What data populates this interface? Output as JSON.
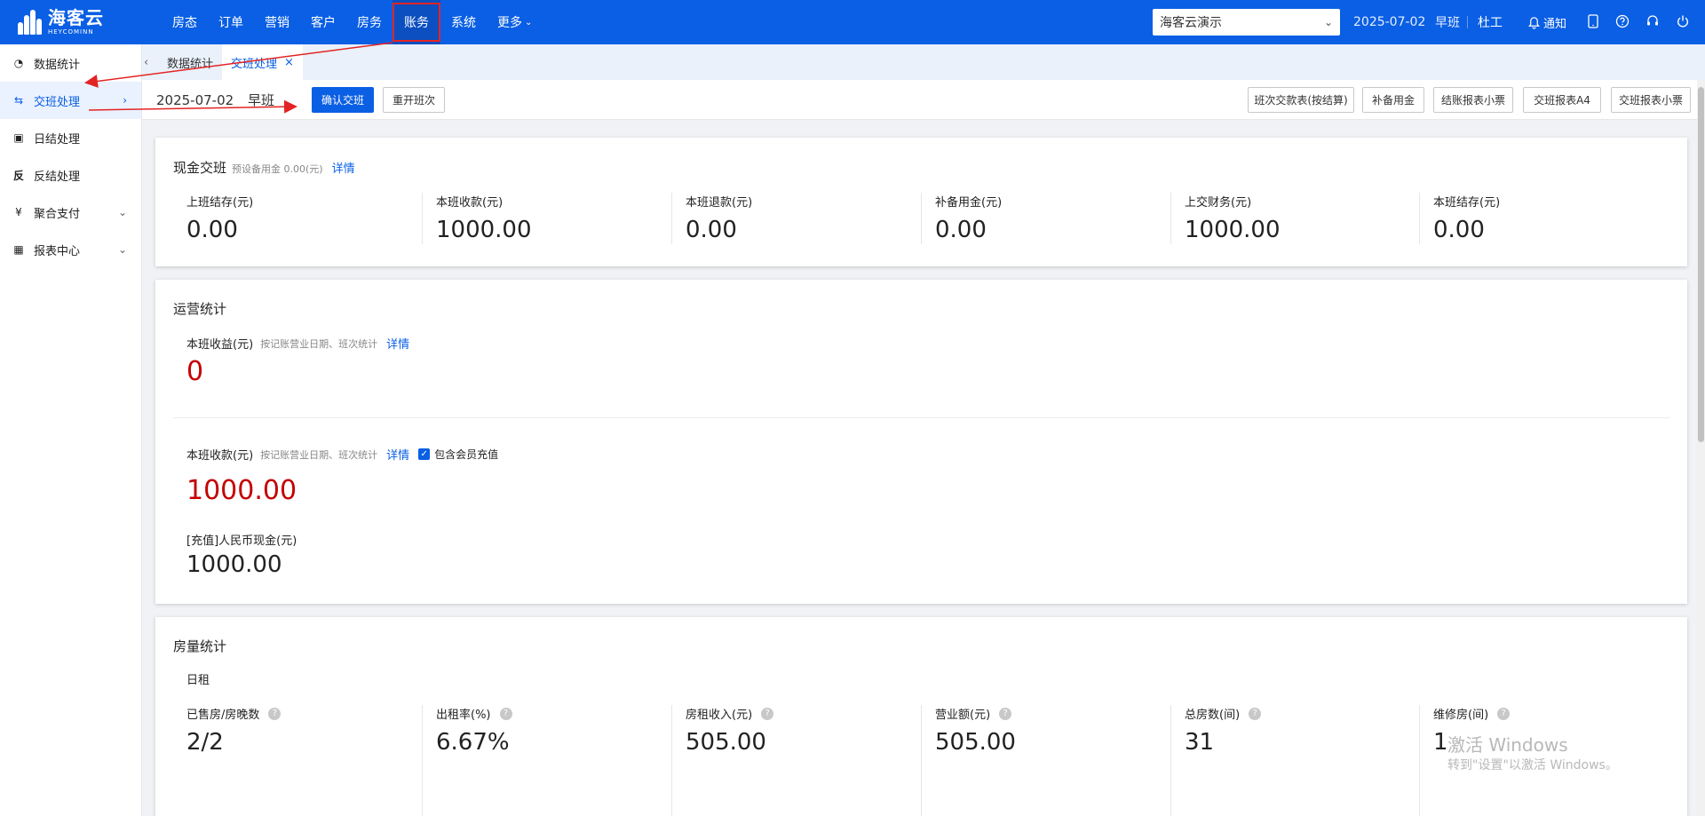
{
  "brand": {
    "name_cn": "海客云",
    "name_en": "HEYCOMINN"
  },
  "nav": {
    "items": [
      {
        "label": "房态"
      },
      {
        "label": "订单"
      },
      {
        "label": "营销"
      },
      {
        "label": "客户"
      },
      {
        "label": "房务"
      },
      {
        "label": "账务",
        "active": true
      },
      {
        "label": "系统"
      },
      {
        "label": "更多"
      }
    ]
  },
  "header": {
    "hotel": "海客云演示",
    "date": "2025-07-02",
    "shift": "早班",
    "user": "杜工",
    "notify": "通知",
    "icons": [
      "bell-icon",
      "tablet-icon",
      "help-icon",
      "headset-icon",
      "power-icon"
    ]
  },
  "sidebar": {
    "items": [
      {
        "label": "数据统计",
        "icon": "pie-chart-icon"
      },
      {
        "label": "交班处理",
        "icon": "exchange-icon",
        "active": true
      },
      {
        "label": "日结处理",
        "icon": "calendar-icon"
      },
      {
        "label": "反结处理",
        "icon": "reverse-icon"
      },
      {
        "label": "聚合支付",
        "icon": "yuan-icon"
      },
      {
        "label": "报表中心",
        "icon": "report-icon"
      }
    ]
  },
  "tabs": [
    {
      "label": "数据统计"
    },
    {
      "label": "交班处理",
      "active": true
    }
  ],
  "toolbar": {
    "date": "2025-07-02",
    "shift": "早班",
    "confirm": "确认交班",
    "reopen": "重开班次",
    "actions": [
      "班次交款表(按结算)",
      "补备用金",
      "结账报表小票",
      "交班报表A4",
      "交班报表小票"
    ]
  },
  "cash": {
    "title": "现金交班",
    "sub": "预设备用金 0.00(元)",
    "detail": "详情",
    "stats": [
      {
        "label": "上班结存(元)",
        "value": "0.00"
      },
      {
        "label": "本班收款(元)",
        "value": "1000.00"
      },
      {
        "label": "本班退款(元)",
        "value": "0.00"
      },
      {
        "label": "补备用金(元)",
        "value": "0.00"
      },
      {
        "label": "上交财务(元)",
        "value": "1000.00"
      },
      {
        "label": "本班结存(元)",
        "value": "0.00"
      }
    ]
  },
  "ops": {
    "title": "运营统计",
    "income_label": "本班收益(元)",
    "income_note": "按记账营业日期、班次统计",
    "income_detail": "详情",
    "income_value": "0",
    "receipts_label": "本班收款(元)",
    "receipts_note": "按记账营业日期、班次统计",
    "receipts_detail": "详情",
    "member_recharge": "包含会员充值",
    "receipts_value": "1000.00",
    "cash_label": "[充值]人民币现金(元)",
    "cash_value": "1000.00"
  },
  "rooms": {
    "title": "房量统计",
    "section": "日租",
    "stats": [
      {
        "label": "已售房/房晚数",
        "value": "2/2"
      },
      {
        "label": "出租率(%)",
        "value": "6.67%"
      },
      {
        "label": "房租收入(元)",
        "value": "505.00"
      },
      {
        "label": "营业额(元)",
        "value": "505.00"
      },
      {
        "label": "总房数(间)",
        "value": "31"
      },
      {
        "label": "维修房(间)",
        "value": "1"
      }
    ]
  },
  "watermark": {
    "line1": "激活 Windows",
    "line2": "转到\"设置\"以激活 Windows。"
  },
  "colors": {
    "primary": "#0a5fe4",
    "danger": "#c40000",
    "annotation": "#e32424"
  }
}
